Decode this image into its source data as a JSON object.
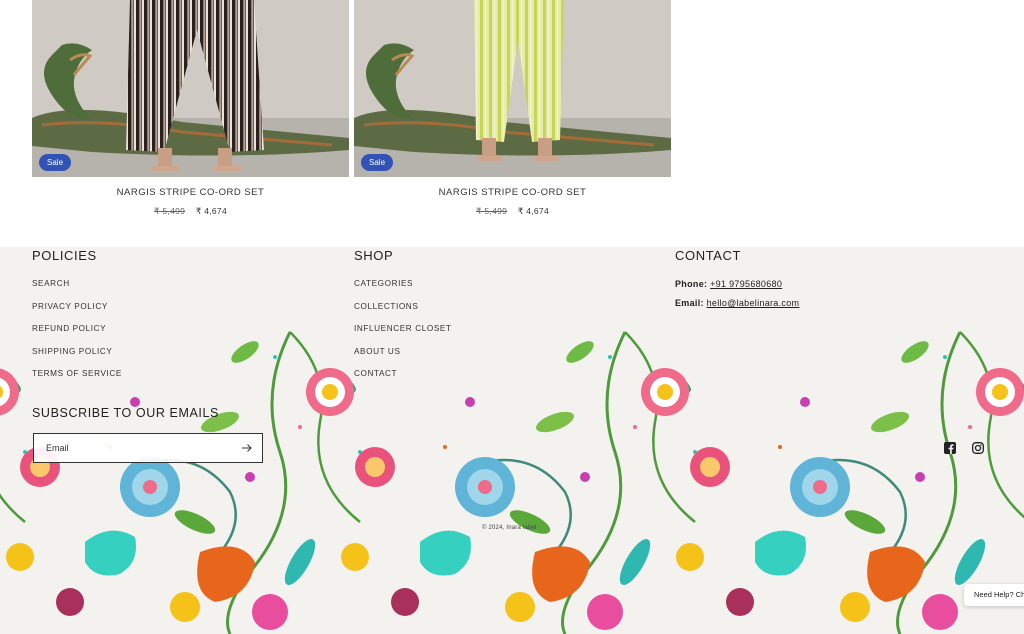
{
  "products": [
    {
      "badge": "Sale",
      "title": "NARGIS STRIPE CO-ORD SET",
      "compare_price": "₹ 5,499",
      "sale_price": "₹ 4,674",
      "variant": "black-stripe"
    },
    {
      "badge": "Sale",
      "title": "NARGIS STRIPE CO-ORD SET",
      "compare_price": "₹ 5,499",
      "sale_price": "₹ 4,674",
      "variant": "lime-stripe"
    }
  ],
  "footer": {
    "policies": {
      "heading": "POLICIES",
      "links": [
        "SEARCH",
        "PRIVACY POLICY",
        "REFUND POLICY",
        "SHIPPING POLICY",
        "TERMS OF SERVICE"
      ]
    },
    "shop": {
      "heading": "SHOP",
      "links": [
        "CATEGORIES",
        "COLLECTIONS",
        "INFLUENCER CLOSET",
        "ABOUT US",
        "CONTACT"
      ]
    },
    "contact": {
      "heading": "CONTACT",
      "phone_label": "Phone",
      "phone": "+91 9795680680",
      "email_label": "Email",
      "email": "hello@labelinara.com"
    },
    "newsletter": {
      "heading": "SUBSCRIBE TO OUR EMAILS",
      "placeholder": "Email"
    },
    "social": [
      "facebook-icon",
      "instagram-icon"
    ],
    "copyright": "© 2024, Inara label"
  },
  "chat_widget": {
    "label": "Need Help? Ch"
  },
  "colors": {
    "sale_badge": "#3352b6",
    "footer_bg": "#f4f2ef",
    "text": "#222222"
  }
}
